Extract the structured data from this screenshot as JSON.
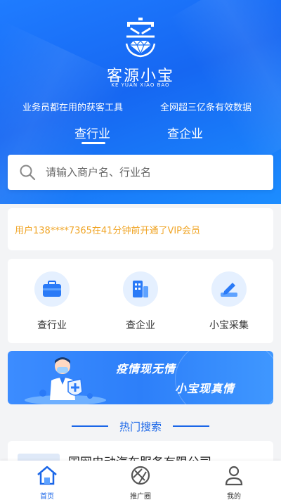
{
  "header": {
    "app_name": "客源小宝",
    "app_subtitle": "KE YUAN XIAO BAO",
    "slogan_left": "业务员都在用的获客工具",
    "slogan_right": "全网超三亿条有效数据",
    "tabs": [
      {
        "label": "查行业",
        "active": true
      },
      {
        "label": "查企业",
        "active": false
      }
    ],
    "brand_color": "#1a6cf5"
  },
  "search": {
    "placeholder": "请输入商户名、行业名",
    "value": ""
  },
  "notice": {
    "text": "用户138****7365在41分钟前开通了VIP会员",
    "color": "#f0a526"
  },
  "quick_actions": [
    {
      "label": "查行业",
      "icon": "briefcase-icon"
    },
    {
      "label": "查企业",
      "icon": "building-icon"
    },
    {
      "label": "小宝采集",
      "icon": "edit-icon"
    }
  ],
  "banner": {
    "line1": "疫情现无情",
    "line2": "小宝现真情"
  },
  "hot_search": {
    "title": "热门搜索",
    "items": [
      {
        "name": "国网电动汽车服务有限公司"
      }
    ]
  },
  "bottom_nav": [
    {
      "label": "首页",
      "icon": "home-icon",
      "active": true
    },
    {
      "label": "推广圈",
      "icon": "promotion-circle-icon",
      "active": false
    },
    {
      "label": "我的",
      "icon": "user-icon",
      "active": false
    }
  ]
}
